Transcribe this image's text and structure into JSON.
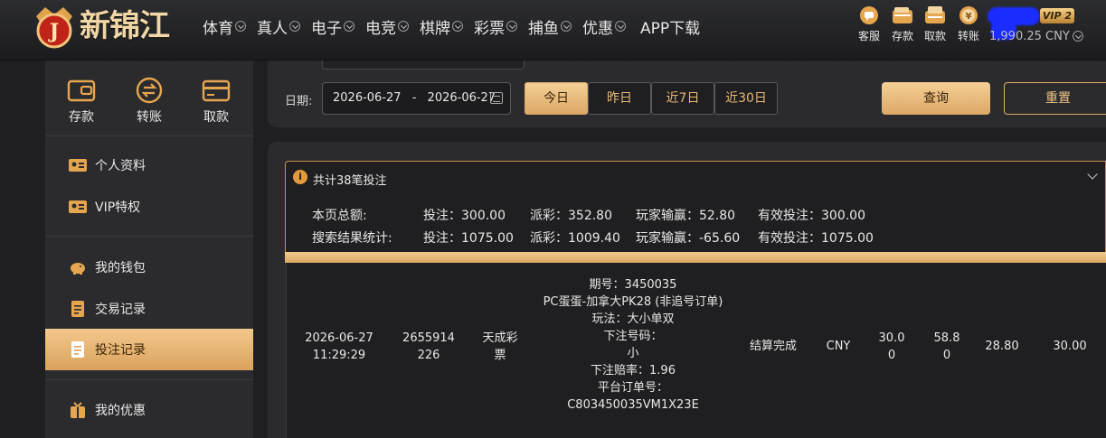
{
  "brand": {
    "name": "新锦江",
    "logo_letter": "J"
  },
  "nav": [
    "体育",
    "真人",
    "电子",
    "电竞",
    "棋牌",
    "彩票",
    "捕鱼",
    "优惠",
    "APP下载"
  ],
  "quick_actions": [
    "客服",
    "存款",
    "取款",
    "转账"
  ],
  "user": {
    "vip": "VIP 2",
    "balance": "1,990.25 CNY"
  },
  "sidebar": {
    "actions": [
      "存款",
      "转账",
      "取款"
    ],
    "menu": [
      "个人资料",
      "VIP特权",
      "我的钱包",
      "交易记录",
      "投注记录",
      "我的优惠"
    ],
    "active": "投注记录"
  },
  "filter": {
    "date_label": "日期:",
    "date_start": "2026-06-27",
    "date_sep": "-",
    "date_end": "2026-06-27",
    "ranges": [
      "今日",
      "昨日",
      "近7日",
      "近30日"
    ],
    "query": "查询",
    "reset": "重置"
  },
  "summary": {
    "count_text": "共计38笔投注",
    "page_label": "本页总额:",
    "search_label": "搜索结果统计:",
    "page": {
      "bet": "投注：300.00",
      "payout": "派彩：352.80",
      "win": "玩家输赢：52.80",
      "valid": "有效投注：300.00"
    },
    "search": {
      "bet": "投注：1075.00",
      "payout": "派彩：1009.40",
      "win": "玩家输赢：-65.60",
      "valid": "有效投注：1075.00"
    }
  },
  "record": {
    "time": [
      "2026-06-27",
      "11:29:29"
    ],
    "id": [
      "2655914",
      "226"
    ],
    "platform": [
      "天成彩",
      "票"
    ],
    "detail": [
      "期号：3450035",
      "PC蛋蛋-加拿大PK28 (非追号订单)",
      "玩法：大小单双",
      "下注号码：",
      "小",
      "下注赔率：1.96",
      "平台订单号：",
      "C803450035VM1X23E"
    ],
    "status": "结算完成",
    "currency": "CNY",
    "bet": [
      "30.0",
      "0"
    ],
    "payout": [
      "58.8",
      "0"
    ],
    "win": "28.80",
    "valid": "30.00"
  }
}
